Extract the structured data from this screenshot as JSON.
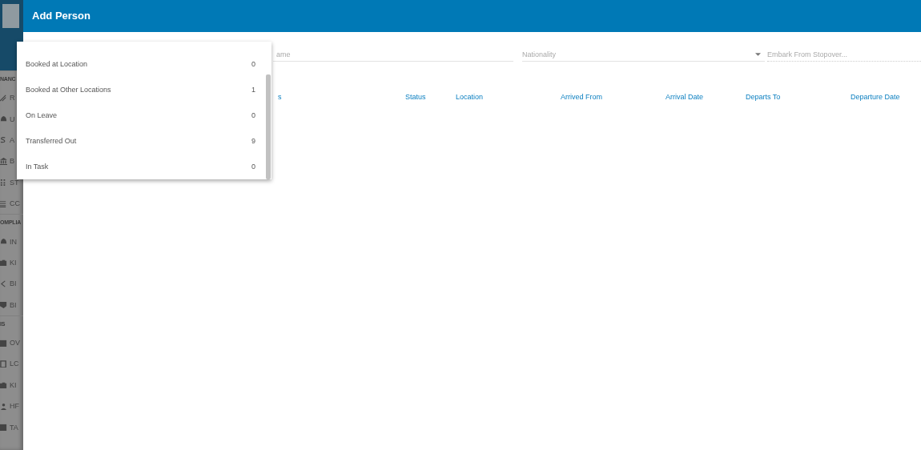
{
  "sidebar": {
    "sections": [
      {
        "heading": "NANC",
        "items": [
          {
            "label": "R"
          },
          {
            "label": "U"
          },
          {
            "label": "A"
          },
          {
            "label": "B"
          },
          {
            "label": "ST"
          },
          {
            "label": "CC"
          }
        ]
      },
      {
        "heading": "OMPLIA",
        "items": [
          {
            "label": "IN"
          },
          {
            "label": "KI"
          },
          {
            "label": "BI"
          },
          {
            "label": "BI"
          }
        ]
      },
      {
        "heading": "IS",
        "items": [
          {
            "label": "OV"
          },
          {
            "label": "LC"
          },
          {
            "label": "KI"
          },
          {
            "label": "HF"
          },
          {
            "label": "TA"
          }
        ]
      }
    ]
  },
  "dialog": {
    "title": "Add Person",
    "fields": [
      {
        "placeholder": "ame",
        "kind": "text"
      },
      {
        "placeholder": "Nationality",
        "kind": "select"
      },
      {
        "placeholder": "Embark From Stopover...",
        "kind": "dotted"
      }
    ],
    "table": {
      "columns": [
        "s",
        "Status",
        "Location",
        "Arrived From",
        "Arrival Date",
        "Departs To",
        "Departure Date"
      ]
    },
    "dropdown": {
      "items": [
        {
          "label": "Booked at Location",
          "count": "0"
        },
        {
          "label": "Booked at Other Locations",
          "count": "1"
        },
        {
          "label": "On Leave",
          "count": "0"
        },
        {
          "label": "Transferred Out",
          "count": "9"
        },
        {
          "label": "In Task",
          "count": "0"
        }
      ]
    }
  }
}
